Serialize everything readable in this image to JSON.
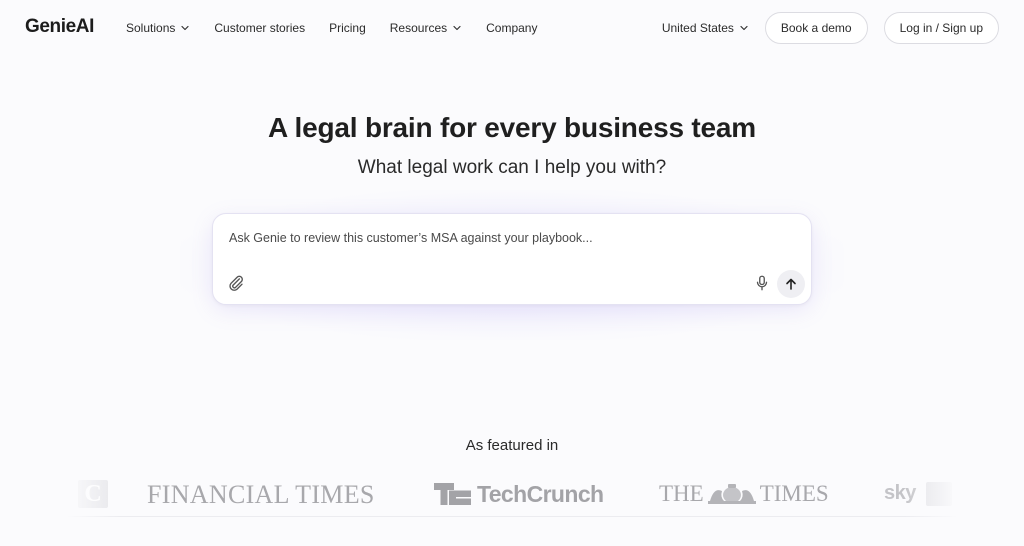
{
  "header": {
    "logo": "GenieAI",
    "nav": [
      {
        "label": "Solutions",
        "has_dropdown": true,
        "icon": "chevron-down-icon"
      },
      {
        "label": "Customer stories",
        "has_dropdown": false
      },
      {
        "label": "Pricing",
        "has_dropdown": false
      },
      {
        "label": "Resources",
        "has_dropdown": true,
        "icon": "chevron-down-icon"
      },
      {
        "label": "Company",
        "has_dropdown": false
      }
    ],
    "region_selector": {
      "label": "United States",
      "icon": "chevron-down-icon"
    },
    "book_demo_label": "Book a demo",
    "login_label": "Log in / Sign up"
  },
  "hero": {
    "headline": "A legal brain for every business team",
    "subheadline": "What legal work can I help you with?"
  },
  "ask_box": {
    "value": "",
    "placeholder": "Ask Genie to review this customer’s MSA against your playbook...",
    "attach_icon": "paperclip-icon",
    "mic_icon": "microphone-icon",
    "send_icon": "arrow-up-icon"
  },
  "featured": {
    "label": "As featured in",
    "logos": [
      {
        "name": "partial-c-logo",
        "text": "C"
      },
      {
        "name": "financial-times-logo",
        "text": "FINANCIAL TIMES"
      },
      {
        "name": "techcrunch-logo",
        "text": "TechCrunch"
      },
      {
        "name": "the-times-logo",
        "text_left": "THE",
        "text_right": "TIMES"
      },
      {
        "name": "sky-news-logo",
        "text": "sky"
      }
    ]
  },
  "colors": {
    "background": "#fbfbfd",
    "text": "#1d1d1f",
    "logo_grey": "#a8a8ac",
    "glow": "#bdb4fa"
  }
}
